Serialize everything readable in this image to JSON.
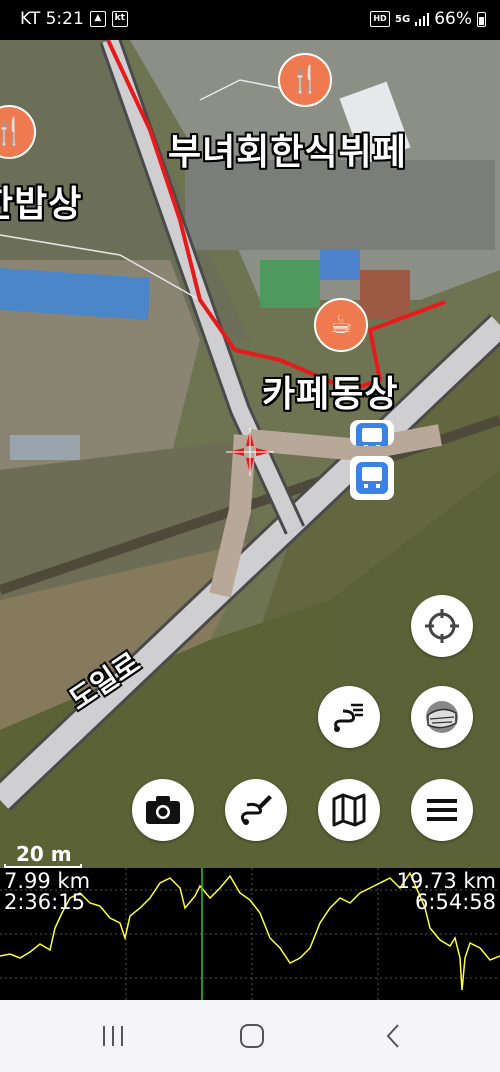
{
  "status_bar": {
    "carrier_time": "KT 5:21",
    "kt_badge": "kt",
    "hd_badge": "HD",
    "network": "5G",
    "battery_percent": "66%"
  },
  "map": {
    "places": [
      {
        "name": "부녀회한식뷔페",
        "icon": "restaurant-icon"
      },
      {
        "name": "한밥상",
        "icon": "restaurant-icon"
      },
      {
        "name": "카페동상",
        "icon": "cafe-icon"
      }
    ],
    "road_name": "도일로",
    "scale_label": "20 m",
    "track_color": "#e8191b",
    "poi_color": "#f07a4f",
    "bus_color": "#3b82e6"
  },
  "controls": [
    {
      "name": "locate-button",
      "icon": "crosshair-icon"
    },
    {
      "name": "route-list-button",
      "icon": "route-list-icon"
    },
    {
      "name": "map-style-button",
      "icon": "layers-icon"
    },
    {
      "name": "camera-button",
      "icon": "camera-icon"
    },
    {
      "name": "draw-route-button",
      "icon": "route-edit-icon"
    },
    {
      "name": "map-button",
      "icon": "map-icon"
    },
    {
      "name": "menu-button",
      "icon": "menu-icon"
    }
  ],
  "profile": {
    "left_distance": "7.99 km",
    "left_time": "2:36:15",
    "right_distance": "19.73 km",
    "right_time": "6:54:58",
    "line_color": "#ffff33",
    "cursor_color": "#22cc22"
  }
}
